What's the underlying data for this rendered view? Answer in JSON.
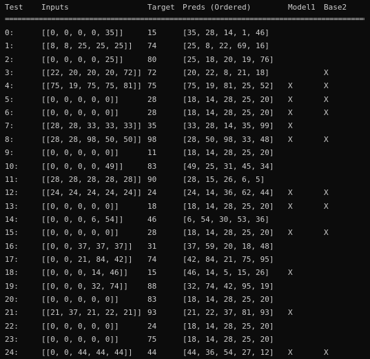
{
  "header": {
    "test": "Test",
    "inputs": "Inputs",
    "target": "Target",
    "preds": "Preds (Ordered)",
    "model": "Model1",
    "base2": "Base2"
  },
  "separator": "==========================================================================================",
  "rows": [
    {
      "test": "0:",
      "inputs": "[[0, 0, 0, 0, 35]]",
      "target": "15",
      "preds": "[35, 28, 14, 1, 46]",
      "model": "",
      "base2": ""
    },
    {
      "test": "1:",
      "inputs": "[[8, 8, 25, 25, 25]]",
      "target": "74",
      "preds": "[25, 8, 22, 69, 16]",
      "model": "",
      "base2": ""
    },
    {
      "test": "2:",
      "inputs": "[[0, 0, 0, 0, 25]]",
      "target": "80",
      "preds": "[25, 18, 20, 19, 76]",
      "model": "",
      "base2": ""
    },
    {
      "test": "3:",
      "inputs": "[[22, 20, 20, 20, 72]]",
      "target": "72",
      "preds": "[20, 22, 8, 21, 18]",
      "model": "",
      "base2": "X"
    },
    {
      "test": "4:",
      "inputs": "[[75, 19, 75, 75, 81]]",
      "target": "75",
      "preds": "[75, 19, 81, 25, 52]",
      "model": "X",
      "base2": "X"
    },
    {
      "test": "5:",
      "inputs": "[[0, 0, 0, 0, 0]]",
      "target": "28",
      "preds": "[18, 14, 28, 25, 20]",
      "model": "X",
      "base2": "X"
    },
    {
      "test": "6:",
      "inputs": "[[0, 0, 0, 0, 0]]",
      "target": "28",
      "preds": "[18, 14, 28, 25, 20]",
      "model": "X",
      "base2": "X"
    },
    {
      "test": "7:",
      "inputs": "[[28, 28, 33, 33, 33]]",
      "target": "35",
      "preds": "[33, 28, 14, 35, 99]",
      "model": "X",
      "base2": ""
    },
    {
      "test": "8:",
      "inputs": "[[28, 28, 98, 50, 50]]",
      "target": "98",
      "preds": "[28, 50, 98, 33, 48]",
      "model": "X",
      "base2": "X"
    },
    {
      "test": "9:",
      "inputs": "[[0, 0, 0, 0, 0]]",
      "target": "11",
      "preds": "[18, 14, 28, 25, 20]",
      "model": "",
      "base2": ""
    },
    {
      "test": "10:",
      "inputs": "[[0, 0, 0, 0, 49]]",
      "target": "83",
      "preds": "[49, 25, 31, 45, 34]",
      "model": "",
      "base2": ""
    },
    {
      "test": "11:",
      "inputs": "[[28, 28, 28, 28, 28]]",
      "target": "90",
      "preds": "[28, 15, 26, 6, 5]",
      "model": "",
      "base2": ""
    },
    {
      "test": "12:",
      "inputs": "[[24, 24, 24, 24, 24]]",
      "target": "24",
      "preds": "[24, 14, 36, 62, 44]",
      "model": "X",
      "base2": "X"
    },
    {
      "test": "13:",
      "inputs": "[[0, 0, 0, 0, 0]]",
      "target": "18",
      "preds": "[18, 14, 28, 25, 20]",
      "model": "X",
      "base2": "X"
    },
    {
      "test": "14:",
      "inputs": "[[0, 0, 0, 6, 54]]",
      "target": "46",
      "preds": "[6, 54, 30, 53, 36]",
      "model": "",
      "base2": ""
    },
    {
      "test": "15:",
      "inputs": "[[0, 0, 0, 0, 0]]",
      "target": "28",
      "preds": "[18, 14, 28, 25, 20]",
      "model": "X",
      "base2": "X"
    },
    {
      "test": "16:",
      "inputs": "[[0, 0, 37, 37, 37]]",
      "target": "31",
      "preds": "[37, 59, 20, 18, 48]",
      "model": "",
      "base2": ""
    },
    {
      "test": "17:",
      "inputs": "[[0, 0, 21, 84, 42]]",
      "target": "74",
      "preds": "[42, 84, 21, 75, 95]",
      "model": "",
      "base2": ""
    },
    {
      "test": "18:",
      "inputs": "[[0, 0, 0, 14, 46]]",
      "target": "15",
      "preds": "[46, 14, 5, 15, 26]",
      "model": "X",
      "base2": ""
    },
    {
      "test": "19:",
      "inputs": "[[0, 0, 0, 32, 74]]",
      "target": "88",
      "preds": "[32, 74, 42, 95, 19]",
      "model": "",
      "base2": ""
    },
    {
      "test": "20:",
      "inputs": "[[0, 0, 0, 0, 0]]",
      "target": "83",
      "preds": "[18, 14, 28, 25, 20]",
      "model": "",
      "base2": ""
    },
    {
      "test": "21:",
      "inputs": "[[21, 37, 21, 22, 21]]",
      "target": "93",
      "preds": "[21, 22, 37, 81, 93]",
      "model": "X",
      "base2": ""
    },
    {
      "test": "22:",
      "inputs": "[[0, 0, 0, 0, 0]]",
      "target": "24",
      "preds": "[18, 14, 28, 25, 20]",
      "model": "",
      "base2": ""
    },
    {
      "test": "23:",
      "inputs": "[[0, 0, 0, 0, 0]]",
      "target": "75",
      "preds": "[18, 14, 28, 25, 20]",
      "model": "",
      "base2": ""
    },
    {
      "test": "24:",
      "inputs": "[[0, 0, 44, 44, 44]]",
      "target": "44",
      "preds": "[44, 36, 54, 27, 12]",
      "model": "X",
      "base2": "X"
    }
  ]
}
